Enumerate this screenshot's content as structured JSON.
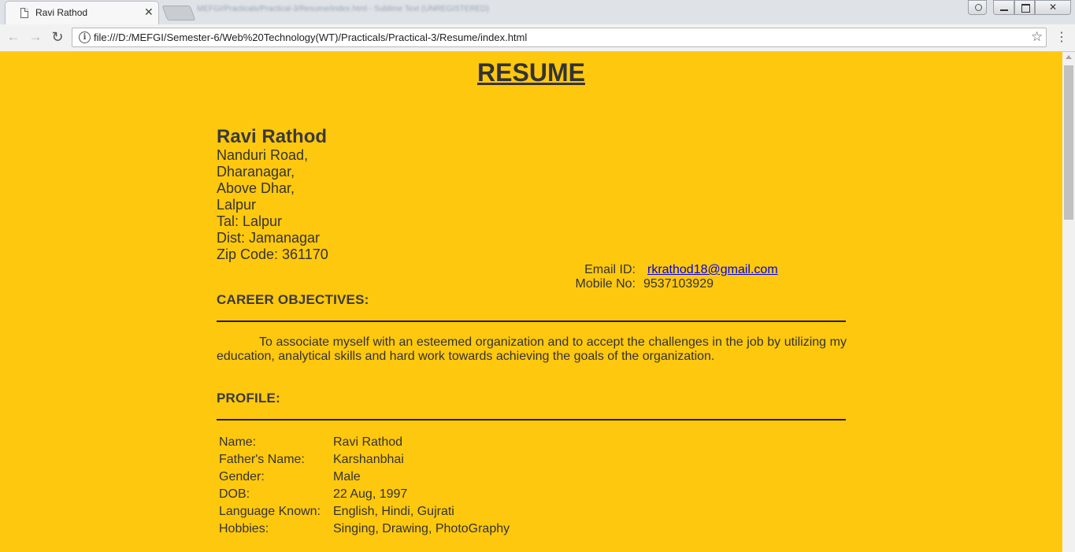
{
  "browser": {
    "tab_title": "Ravi Rathod",
    "tab_close": "✕",
    "blurred_title": "MEFGI/Practicals/Practical-3/Resume/index.html - Sublime Text (UNREGISTERED)",
    "url": "file:///D:/MEFGI/Semester-6/Web%20Technology(WT)/Practicals/Practical-3/Resume/index.html",
    "icons": {
      "back": "←",
      "forward": "→",
      "reload": "↻",
      "info": "i",
      "star": "☆",
      "menu": "⋮",
      "close": "✕"
    }
  },
  "page": {
    "background_color": "#fec80e",
    "heading": "RESUME",
    "name": "Ravi Rathod",
    "address": [
      "Nanduri Road,",
      "Dharanagar,",
      "Above Dhar,",
      "Lalpur",
      "Tal: Lalpur",
      "Dist: Jamanagar",
      "Zip Code: 361170"
    ],
    "contact": {
      "email_label": "Email ID:",
      "email": "rkrathod18@gmail.com",
      "mobile_label": "Mobile No:",
      "mobile": "9537103929"
    },
    "career": {
      "title": "CAREER OBJECTIVES:",
      "text": "To associate myself with an esteemed organization and to accept the challenges in the job by utilizing my education, analytical skills and hard work towards achieving the goals of the organization."
    },
    "profile": {
      "title": "PROFILE:",
      "rows": [
        {
          "label": "Name:",
          "value": "Ravi Rathod"
        },
        {
          "label": "Father's Name:",
          "value": "Karshanbhai"
        },
        {
          "label": "Gender:",
          "value": "Male"
        },
        {
          "label": "DOB:",
          "value": "22 Aug, 1997"
        },
        {
          "label": "Language Known:",
          "value": "English, Hindi, Gujrati"
        },
        {
          "label": "Hobbies:",
          "value": "Singing, Drawing, PhotoGraphy"
        }
      ]
    }
  }
}
